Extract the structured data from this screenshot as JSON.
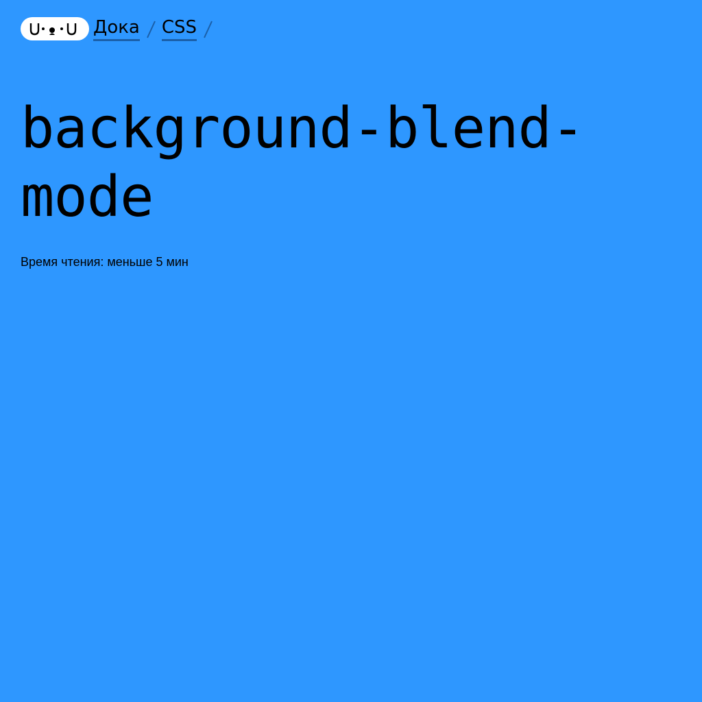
{
  "header": {
    "logo_icon": "doka-face-logo-icon",
    "breadcrumbs": [
      {
        "label": "Дока"
      },
      {
        "label": "CSS"
      }
    ],
    "separator_icon": "slash-separator-icon"
  },
  "article": {
    "title": "background-blend-mode",
    "reading_time": "Время чтения: меньше 5 мин"
  },
  "colors": {
    "background": "#2e97ff",
    "text": "#000000",
    "logo_bg": "#ffffff",
    "link_underline": "#1b5fa8"
  }
}
